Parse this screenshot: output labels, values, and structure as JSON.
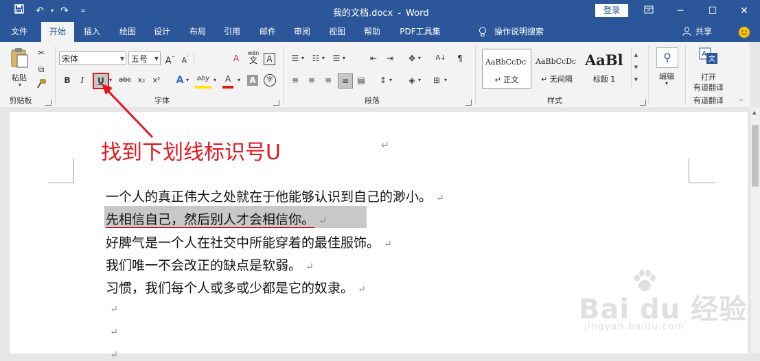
{
  "titlebar": {
    "doc_title": "我的文档.docx",
    "app_name": "Word",
    "login_label": "登录",
    "undo_icon": "undo-icon",
    "redo_icon": "redo-icon",
    "save_icon": "save-icon"
  },
  "tabs": [
    "文件",
    "开始",
    "插入",
    "绘图",
    "设计",
    "布局",
    "引用",
    "邮件",
    "审阅",
    "视图",
    "帮助",
    "PDF工具集"
  ],
  "tell_me": "操作说明搜索",
  "share_label": "共享",
  "ribbon": {
    "clipboard": {
      "paste_label": "粘贴",
      "group_label": "剪贴板"
    },
    "font": {
      "font_name": "宋体",
      "font_size": "五号",
      "bold": "B",
      "italic": "I",
      "underline": "U",
      "strike": "abc",
      "subscript": "x₂",
      "superscript": "x²",
      "group_label": "字体",
      "grow": "A",
      "shrink": "A",
      "clear_format": "A",
      "phonetic_top": "wén",
      "phonetic_main": "文",
      "border_char": "A",
      "highlight": "aby",
      "font_color": "A",
      "char_shade": "A",
      "enclose": "字"
    },
    "paragraph": {
      "group_label": "段落"
    },
    "styles": {
      "items": [
        {
          "preview": "AaBbCcDc",
          "name": "↵ 正文"
        },
        {
          "preview": "AaBbCcDc",
          "name": "↵ 无间隔"
        },
        {
          "preview": "AaBl",
          "name": "标题 1"
        }
      ],
      "group_label": "样式"
    },
    "editing": {
      "label": "编辑"
    },
    "translate": {
      "line1": "打开",
      "line2": "有道翻译",
      "group_label": "有道翻译"
    }
  },
  "annotation": {
    "text": "找到下划线标识号U",
    "color": "#e8141c"
  },
  "document": {
    "lines": [
      "一个人的真正伟大之处就在于他能够认识到自己的渺小。",
      "先相信自己，然后别人才会相信你。",
      "好脾气是一个人在社交中所能穿着的最佳服饰。",
      "我们唯一不会改正的缺点是软弱。",
      "习惯，我们每个人或多或少都是它的奴隶。",
      "",
      "",
      ""
    ],
    "selected_line_index": 1,
    "paragraph_mark": "↵"
  },
  "watermark": {
    "brand": "Bai du 经验",
    "url": "jingyan.baidu.com"
  },
  "colors": {
    "word_blue": "#2b579a",
    "ribbon_bg": "#f3f3f3",
    "selection": "#c8c8c8",
    "underline_red": "#c0151c"
  }
}
